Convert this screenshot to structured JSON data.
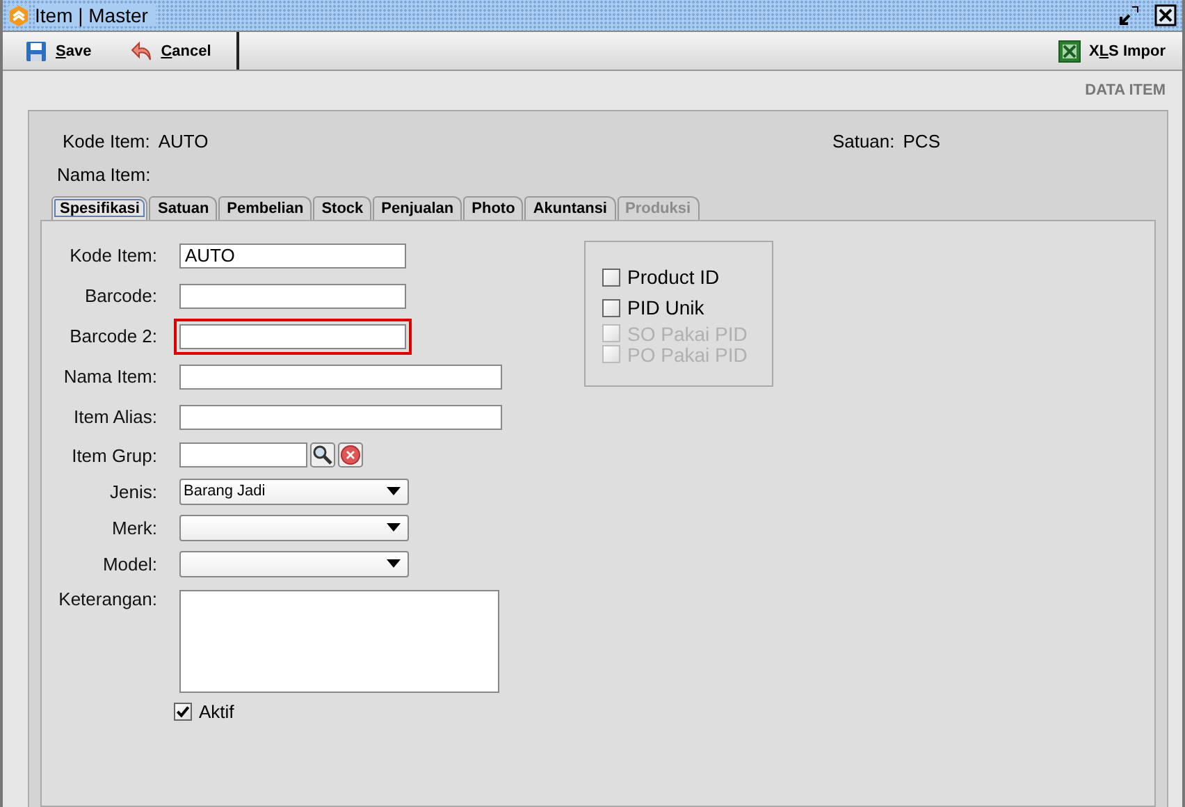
{
  "window": {
    "title": "Item | Master"
  },
  "toolbar": {
    "buttons": [
      {
        "kind": "save",
        "label": "Save"
      },
      {
        "kind": "cancel",
        "label": "Cancel"
      }
    ],
    "import": {
      "mnemonic": "L",
      "before": "X",
      "after": "S Impor"
    }
  },
  "section_title": "DATA ITEM",
  "header": {
    "kode_label": "Kode Item:",
    "kode_value": "AUTO",
    "satuan_label": "Satuan:",
    "satuan_value": "PCS",
    "nama_label": "Nama Item:"
  },
  "tabs": [
    {
      "label": "Spesifikasi",
      "selected": true,
      "disabled": false
    },
    {
      "label": "Satuan",
      "selected": false,
      "disabled": false
    },
    {
      "label": "Pembelian",
      "selected": false,
      "disabled": false
    },
    {
      "label": "Stock",
      "selected": false,
      "disabled": false
    },
    {
      "label": "Penjualan",
      "selected": false,
      "disabled": false
    },
    {
      "label": "Photo",
      "selected": false,
      "disabled": false
    },
    {
      "label": "Akuntansi",
      "selected": false,
      "disabled": false
    },
    {
      "label": "Produksi",
      "selected": false,
      "disabled": true
    }
  ],
  "fields": [
    {
      "kind": "short",
      "label": "Kode Item:",
      "value": "AUTO"
    },
    {
      "kind": "short",
      "label": "Barcode:"
    },
    {
      "kind": "short",
      "label": "Barcode 2:",
      "highlighted": true
    },
    {
      "kind": "long",
      "label": "Nama Item:"
    },
    {
      "kind": "long",
      "label": "Item Alias:"
    },
    {
      "kind": "lookup",
      "label": "Item Grup:"
    },
    {
      "kind": "combo",
      "label": "Jenis:",
      "value": "Barang Jadi"
    },
    {
      "kind": "combo",
      "label": "Merk:"
    },
    {
      "kind": "combo",
      "label": "Model:"
    },
    {
      "kind": "memo",
      "label": "Keterangan:"
    }
  ],
  "aktif": {
    "label": "Aktif",
    "checked": true
  },
  "pid_options": [
    {
      "label": "Product ID",
      "checked": false,
      "disabled": false
    },
    {
      "label": "PID Unik",
      "checked": false,
      "disabled": false
    },
    {
      "label": "SO Pakai PID",
      "checked": false,
      "disabled": true
    },
    {
      "label": "PO Pakai PID",
      "checked": false,
      "disabled": true
    }
  ]
}
